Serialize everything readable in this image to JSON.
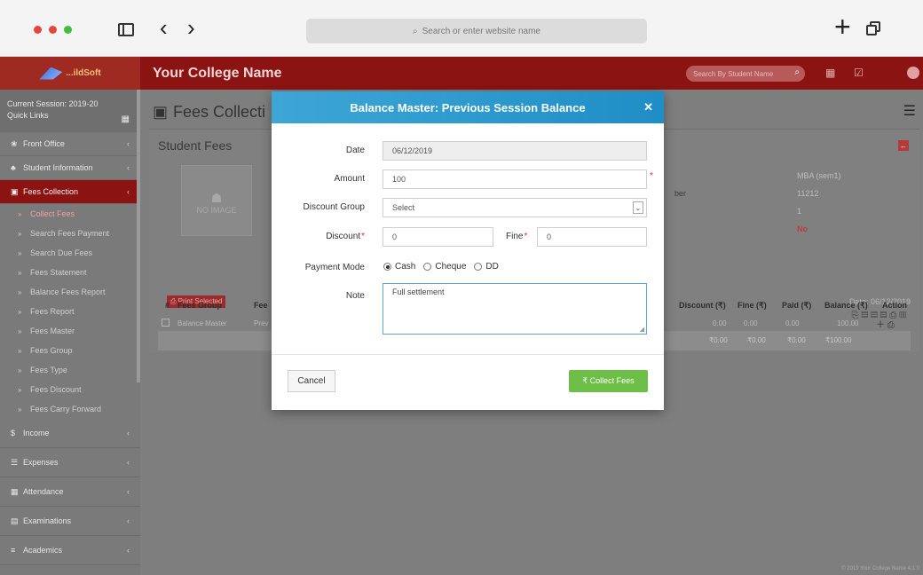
{
  "browser": {
    "address_placeholder": "Search or enter website name",
    "dot_colors": [
      "#e5463c",
      "#e5463c",
      "#3fbf3f"
    ]
  },
  "header": {
    "logo_text": "...ildSoft",
    "college_name": "Your College Name",
    "search_placeholder": "Search By Student Name",
    "brand_color": "#8b1312"
  },
  "sidebar": {
    "session_label": "Current Session: 2019-20",
    "quick_links": "Quick Links",
    "items_top": [
      {
        "icon": "❀",
        "label": "Front Office"
      },
      {
        "icon": "♣",
        "label": "Student Information"
      },
      {
        "icon": "▣",
        "label": "Fees Collection"
      }
    ],
    "sub_items": [
      "Collect Fees",
      "Search Fees Payment",
      "Search Due Fees",
      "Fees Statement",
      "Balance Fees Report",
      "Fees Report",
      "Fees Master",
      "Fees Group",
      "Fees Type",
      "Fees Discount",
      "Fees Carry Forward"
    ],
    "items_bottom": [
      {
        "icon": "$",
        "label": "Income"
      },
      {
        "icon": "☰",
        "label": "Expenses"
      },
      {
        "icon": "▦",
        "label": "Attendance"
      },
      {
        "icon": "▤",
        "label": "Examinations"
      },
      {
        "icon": "≡",
        "label": "Academics"
      }
    ]
  },
  "main": {
    "page_title": "Fees Collecti",
    "panel_title": "Student Fees",
    "no_image": "NO IMAGE",
    "info": [
      {
        "label": "",
        "value": "MBA (sem1)"
      },
      {
        "label": "ber",
        "value": "11212"
      },
      {
        "label": "",
        "value": "1"
      },
      {
        "label": "",
        "value": "No"
      }
    ],
    "print_selected": "Print Selected",
    "date_label": "Date: 06/12/2019",
    "table_headers": {
      "hash": "#",
      "fees_group": "Fees Group",
      "fees_code": "Fee",
      "discount": "Discount (₹)",
      "fine": "Fine (₹)",
      "paid": "Paid (₹)",
      "balance": "Balance (₹)",
      "action": "Action"
    },
    "row": {
      "fees_group": "Balance Master",
      "fees_code": "Prev",
      "discount": "0.00",
      "fine": "0.00",
      "paid": "0.00",
      "balance": "100.00"
    },
    "totals": {
      "discount": "₹0.00",
      "fine": "₹0.00",
      "paid": "₹0.00",
      "balance": "₹100.00"
    },
    "footer": "© 2019 Your College Name 4.1.0"
  },
  "modal": {
    "title": "Balance Master: Previous Session Balance",
    "date_label": "Date",
    "date_value": "06/12/2019",
    "amount_label": "Amount",
    "amount_value": "100",
    "discount_group_label": "Discount Group",
    "discount_group_value": "Select",
    "discount_label": "Discount",
    "discount_value": "0",
    "fine_label": "Fine",
    "fine_value": "0",
    "payment_mode_label": "Payment Mode",
    "payment_modes": [
      "Cash",
      "Cheque",
      "DD"
    ],
    "payment_selected": "Cash",
    "note_label": "Note",
    "note_value": "Full settlement",
    "cancel_label": "Cancel",
    "collect_label": "₹ Collect Fees",
    "header_color": "#2a98cc",
    "collect_color": "#6dbf47"
  }
}
